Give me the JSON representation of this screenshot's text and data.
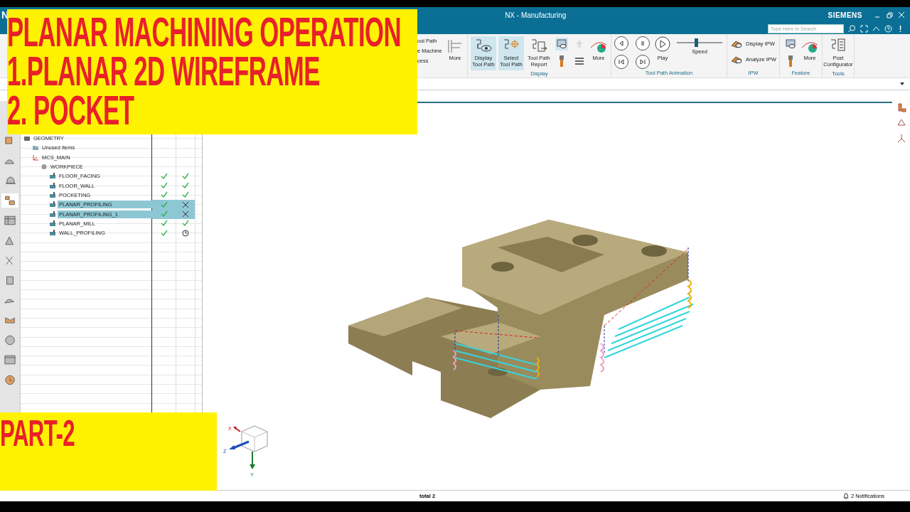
{
  "window": {
    "app_letter": "N",
    "title": "NX - Manufacturing",
    "brand": "SIEMENS",
    "search": {
      "placeholder": "Type Here to Search"
    }
  },
  "ribbon": {
    "cut_labels": [
      "ool Path",
      "e Machine",
      "cess"
    ],
    "more_label": "More",
    "groups": [
      {
        "label": "Display",
        "items": [
          {
            "kind": "large",
            "label": "Display Tool Path",
            "selected": true
          },
          {
            "kind": "large",
            "label": "Select Tool Path",
            "selected": true
          },
          {
            "kind": "large",
            "label": "Tool Path Report",
            "selected": false
          },
          {
            "kind": "stack",
            "selected": true
          },
          {
            "kind": "arrows",
            "disabled": true
          },
          {
            "kind": "more",
            "label": "More"
          }
        ]
      },
      {
        "label": "Tool Path Animation",
        "items": [
          {
            "kind": "media"
          },
          {
            "kind": "play",
            "label": "Play"
          },
          {
            "kind": "slider",
            "label": "Speed",
            "level": 0.42
          }
        ]
      },
      {
        "label": "IPW",
        "items": [
          {
            "kind": "rows",
            "labels": [
              "Display IPW",
              "Analyze IPW"
            ]
          }
        ]
      },
      {
        "label": "Feature",
        "items": [
          {
            "kind": "stack",
            "selected": false
          },
          {
            "kind": "more",
            "label": "More"
          }
        ]
      },
      {
        "label": "Tools",
        "items": [
          {
            "kind": "large",
            "label": "Post Configurator",
            "selected": false
          }
        ]
      }
    ]
  },
  "left_toolbar": [
    {
      "selected": false
    },
    {
      "selected": false
    },
    {
      "selected": false
    },
    {
      "selected": true
    },
    {
      "selected": false
    },
    {
      "selected": false
    },
    {
      "selected": false
    },
    {
      "selected": false
    },
    {
      "selected": false
    },
    {
      "selected": false
    },
    {
      "selected": false
    },
    {
      "selected": false
    },
    {
      "selected": false
    }
  ],
  "navigator": {
    "tree": [
      {
        "name": "GEOMETRY",
        "kind": "group",
        "children": [
          {
            "name": "Unused Items",
            "kind": "folder"
          },
          {
            "name": "MCS_MAIN",
            "kind": "csys",
            "children": [
              {
                "name": "WORKPIECE",
                "kind": "workpiece",
                "children": [
                  {
                    "name": "FLOOR_FACING",
                    "kind": "operation",
                    "selected": false,
                    "generated": true,
                    "verified": true,
                    "pending": false
                  },
                  {
                    "name": "FLOOR_WALL",
                    "kind": "operation",
                    "selected": false,
                    "generated": true,
                    "verified": true,
                    "pending": false
                  },
                  {
                    "name": "POCKETING",
                    "kind": "operation",
                    "selected": false,
                    "generated": true,
                    "verified": true,
                    "pending": false
                  },
                  {
                    "name": "PLANAR_PROFILING",
                    "kind": "operation",
                    "selected": true,
                    "generated": true,
                    "verified": false,
                    "pending": false
                  },
                  {
                    "name": "PLANAR_PROFILING_1",
                    "kind": "operation",
                    "selected": true,
                    "generated": true,
                    "verified": false,
                    "pending": false
                  },
                  {
                    "name": "PLANAR_MILL",
                    "kind": "operation",
                    "selected": false,
                    "generated": true,
                    "verified": true,
                    "pending": false
                  },
                  {
                    "name": "WALL_PROFILING",
                    "kind": "operation",
                    "selected": false,
                    "generated": true,
                    "verified": false,
                    "pending": true
                  }
                ]
              }
            ]
          }
        ]
      }
    ]
  },
  "view_triad": {
    "labels": [
      "X",
      "Z",
      "Y"
    ]
  },
  "status_bar": {
    "selection": "total 2",
    "notifications": "2 Notifications"
  },
  "overlays": {
    "title_lines": [
      "PLANAR MACHINING OPERATION",
      "1.PLANAR 2D WIREFRAME",
      "2. POCKET"
    ],
    "part_label": "PART-2"
  }
}
